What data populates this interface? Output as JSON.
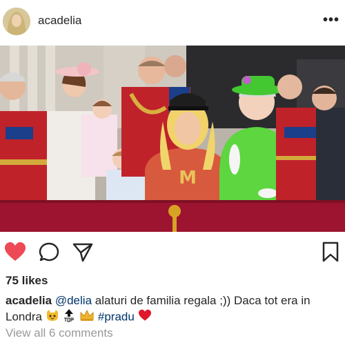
{
  "post": {
    "username": "acadelia",
    "more_label": "•••"
  },
  "icons": {
    "like": "heart-filled-icon",
    "comment": "comment-bubble-icon",
    "share": "paper-plane-icon",
    "save": "bookmark-icon"
  },
  "colors": {
    "heart": "#ed4956",
    "link": "#003569",
    "muted": "#999999"
  },
  "likes": "75 likes",
  "caption": {
    "username": "acadelia",
    "mention": "@delia",
    "text1": " alaturi de familia regala ;)) Daca tot era in",
    "text2": "Londra ",
    "hashtag": "#pradu"
  },
  "comments_link": "View all 6 comments"
}
